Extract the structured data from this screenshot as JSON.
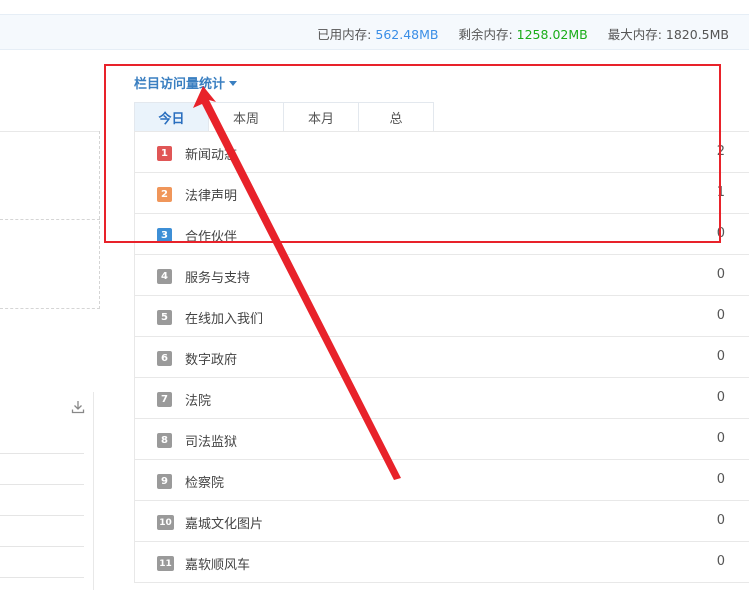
{
  "memory": {
    "used_label": "已用内存:",
    "used_value": "562.48MB",
    "free_label": "剩余内存:",
    "free_value": "1258.02MB",
    "max_label": "最大内存:",
    "max_value": "1820.5MB"
  },
  "panel": {
    "title": "栏目访问量统计",
    "tabs": [
      {
        "label": "今日",
        "active": true
      },
      {
        "label": "本周",
        "active": false
      },
      {
        "label": "本月",
        "active": false
      },
      {
        "label": "总",
        "active": false
      }
    ],
    "rows": [
      {
        "rank": "1",
        "name": "新闻动态",
        "count": "2",
        "badge_color": "#e05656"
      },
      {
        "rank": "2",
        "name": "法律声明",
        "count": "1",
        "badge_color": "#f0965a"
      },
      {
        "rank": "3",
        "name": "合作伙伴",
        "count": "0",
        "badge_color": "#3d8fd6"
      },
      {
        "rank": "4",
        "name": "服务与支持",
        "count": "0",
        "badge_color": "#9a9a9a"
      },
      {
        "rank": "5",
        "name": "在线加入我们",
        "count": "0",
        "badge_color": "#9a9a9a"
      },
      {
        "rank": "6",
        "name": "数字政府",
        "count": "0",
        "badge_color": "#9a9a9a"
      },
      {
        "rank": "7",
        "name": "法院",
        "count": "0",
        "badge_color": "#9a9a9a"
      },
      {
        "rank": "8",
        "name": "司法监狱",
        "count": "0",
        "badge_color": "#9a9a9a"
      },
      {
        "rank": "9",
        "name": "检察院",
        "count": "0",
        "badge_color": "#9a9a9a"
      },
      {
        "rank": "10",
        "name": "嘉城文化图片",
        "count": "0",
        "badge_color": "#9a9a9a"
      },
      {
        "rank": "11",
        "name": "嘉软顺风车",
        "count": "0",
        "badge_color": "#9a9a9a"
      }
    ]
  },
  "annotation_color": "#e8222a"
}
